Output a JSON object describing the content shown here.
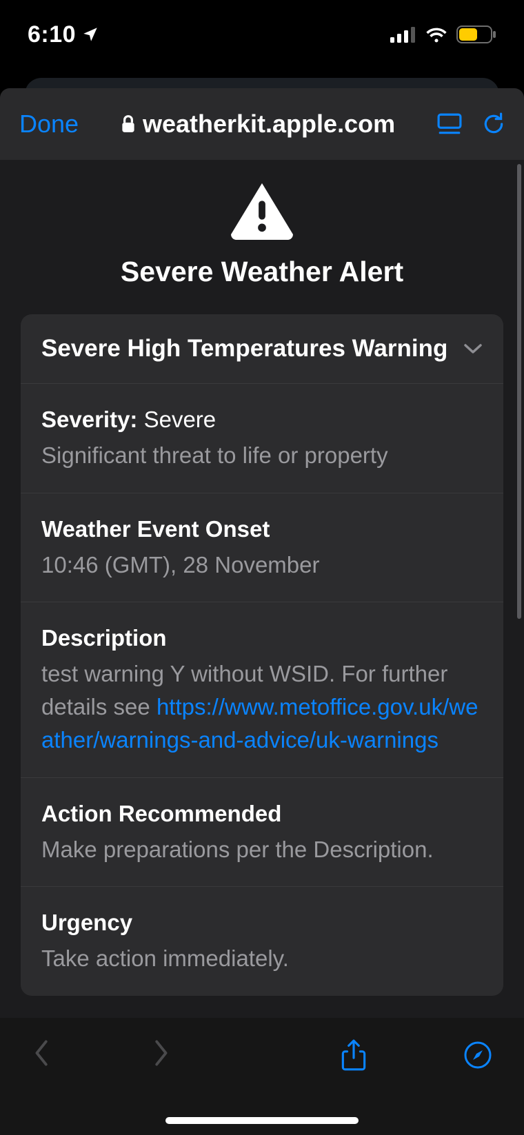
{
  "status": {
    "time": "6:10"
  },
  "browser": {
    "done_label": "Done",
    "url": "weatherkit.apple.com"
  },
  "hero": {
    "title": "Severe Weather Alert"
  },
  "card": {
    "title": "Severe High Temperatures Warning",
    "severity": {
      "label": "Severity:",
      "value": "Severe",
      "sub": "Significant threat to life or property"
    },
    "onset": {
      "label": "Weather Event Onset",
      "value": "10:46 (GMT), 28 November"
    },
    "description": {
      "label": "Description",
      "text": "test warning Y without WSID. For further details see ",
      "link": "https://www.metoffice.gov.uk/weather/warnings-and-advice/uk-warnings"
    },
    "action": {
      "label": "Action Recommended",
      "value": "Make preparations per the Description."
    },
    "urgency": {
      "label": "Urgency",
      "value": "Take action immediately."
    }
  }
}
